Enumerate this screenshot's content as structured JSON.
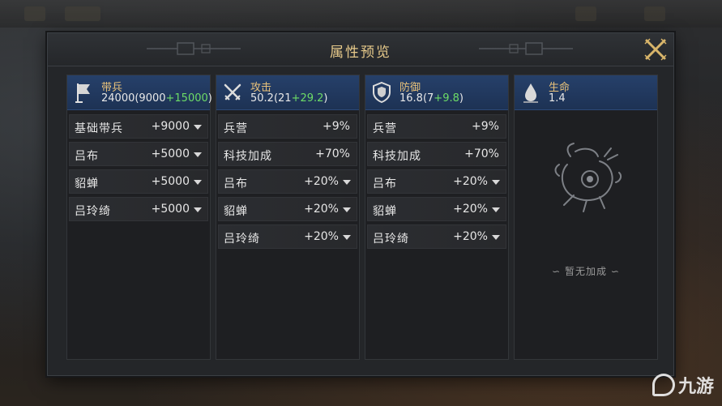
{
  "dialog": {
    "title": "属性预览"
  },
  "columns": [
    {
      "name": "带兵",
      "icon": "banner-icon",
      "value_base": "24000(9000",
      "value_plus": "+15000",
      "value_close": ")",
      "rows": [
        {
          "label": "基础带兵",
          "value": "+9000",
          "dropdown": true
        },
        {
          "label": "吕布",
          "value": "+5000",
          "dropdown": true
        },
        {
          "label": "貂蝉",
          "value": "+5000",
          "dropdown": true
        },
        {
          "label": "吕玲绮",
          "value": "+5000",
          "dropdown": true
        }
      ]
    },
    {
      "name": "攻击",
      "icon": "crossed-swords-icon",
      "value_base": "50.2(21",
      "value_plus": "+29.2",
      "value_close": ")",
      "rows": [
        {
          "label": "兵营",
          "value": "+9%",
          "dropdown": false
        },
        {
          "label": "科技加成",
          "value": "+70%",
          "dropdown": false
        },
        {
          "label": "吕布",
          "value": "+20%",
          "dropdown": true
        },
        {
          "label": "貂蝉",
          "value": "+20%",
          "dropdown": true
        },
        {
          "label": "吕玲绮",
          "value": "+20%",
          "dropdown": true
        }
      ]
    },
    {
      "name": "防御",
      "icon": "shield-icon",
      "value_base": "16.8(7",
      "value_plus": "+9.8",
      "value_close": ")",
      "rows": [
        {
          "label": "兵营",
          "value": "+9%",
          "dropdown": false
        },
        {
          "label": "科技加成",
          "value": "+70%",
          "dropdown": false
        },
        {
          "label": "吕布",
          "value": "+20%",
          "dropdown": true
        },
        {
          "label": "貂蝉",
          "value": "+20%",
          "dropdown": true
        },
        {
          "label": "吕玲绮",
          "value": "+20%",
          "dropdown": true
        }
      ]
    },
    {
      "name": "生命",
      "icon": "drop-icon",
      "value_base": "1.4",
      "value_plus": "",
      "value_close": "",
      "rows": [],
      "empty_text": "暂无加成"
    }
  ],
  "watermark": {
    "text": "九游"
  },
  "colors": {
    "accent_gold": "#e6c98a",
    "bonus_green": "#6ddc67",
    "header_blue": "#26406a"
  }
}
